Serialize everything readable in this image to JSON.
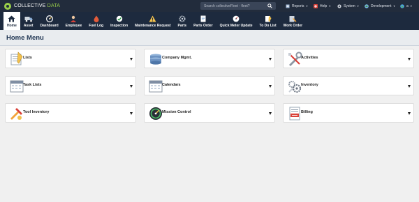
{
  "brand": {
    "name": "COLLECTIVE",
    "accent": "DATA"
  },
  "search": {
    "placeholder": "Search collectiveFleet - fleet?",
    "icon": "search-icon"
  },
  "top_menu": [
    {
      "label": "Reports",
      "icon": "reports-icon"
    },
    {
      "label": "Help",
      "icon": "help-icon"
    },
    {
      "label": "System",
      "icon": "system-icon"
    },
    {
      "label": "Development",
      "icon": "development-icon"
    },
    {
      "label": "a",
      "icon": "user-globe-icon"
    }
  ],
  "nav": [
    {
      "label": "Home",
      "icon": "home-icon",
      "active": true
    },
    {
      "label": "Asset",
      "icon": "truck-icon"
    },
    {
      "label": "Dashboard",
      "icon": "dashboard-icon"
    },
    {
      "label": "Employee",
      "icon": "employee-icon"
    },
    {
      "label": "Fuel Log",
      "icon": "fuel-icon"
    },
    {
      "label": "Inspection",
      "icon": "inspection-icon"
    },
    {
      "label": "Maintenance Request",
      "icon": "maintenance-icon"
    },
    {
      "label": "Parts",
      "icon": "parts-icon"
    },
    {
      "label": "Parts Order",
      "icon": "parts-order-icon"
    },
    {
      "label": "Quick Meter Update",
      "icon": "meter-icon"
    },
    {
      "label": "To Do List",
      "icon": "todo-icon"
    },
    {
      "label": "Work Order",
      "icon": "work-order-icon"
    }
  ],
  "page": {
    "title": "Home Menu"
  },
  "cards": [
    {
      "label": "Lists",
      "icon": "lists-icon"
    },
    {
      "label": "Company Mgmt.",
      "icon": "company-icon"
    },
    {
      "label": "Activities",
      "icon": "activities-icon"
    },
    {
      "label": "Task Lists",
      "icon": "task-lists-icon"
    },
    {
      "label": "Calendars",
      "icon": "calendars-icon"
    },
    {
      "label": "Inventory",
      "icon": "inventory-icon"
    },
    {
      "label": "Tool Inventory",
      "icon": "tool-inventory-icon"
    },
    {
      "label": "Mission Control",
      "icon": "mission-control-icon"
    },
    {
      "label": "Billing",
      "icon": "billing-icon"
    }
  ],
  "colors": {
    "topbar": "#222c3c",
    "navbar": "#1d2a3e",
    "brand_accent": "#9ad04a",
    "title_text": "#1f3552",
    "page_bg": "#f0f0f0"
  }
}
